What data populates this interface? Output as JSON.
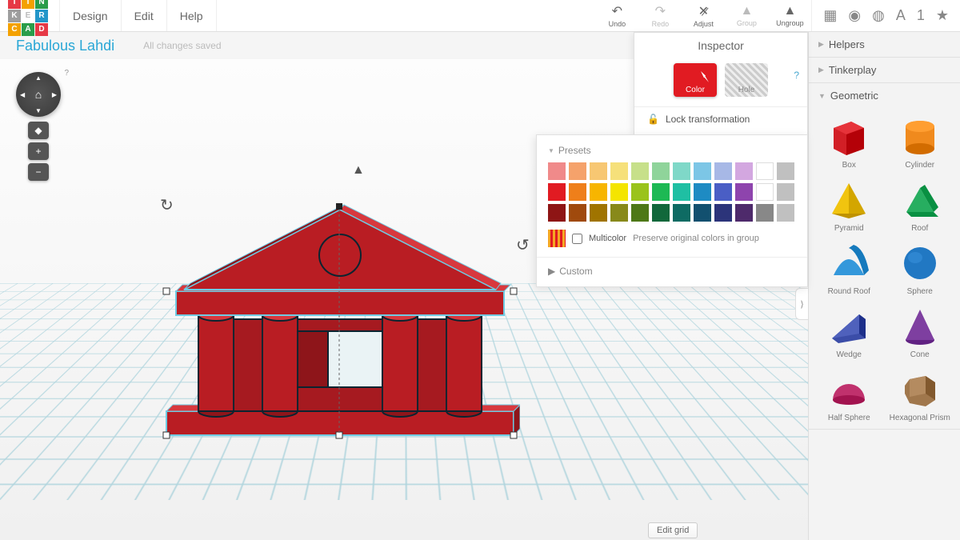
{
  "logo": [
    {
      "t": "T",
      "c": "#e63946"
    },
    {
      "t": "I",
      "c": "#f4a100"
    },
    {
      "t": "N",
      "c": "#2a9d4a"
    },
    {
      "t": "K",
      "c": "#9e9e9e"
    },
    {
      "t": "E",
      "c": "#fff",
      "bg": "#fff",
      "fg": "#bbb"
    },
    {
      "t": "R",
      "c": "#2396c9"
    },
    {
      "t": "C",
      "c": "#f4a100"
    },
    {
      "t": "A",
      "c": "#2a9d4a"
    },
    {
      "t": "D",
      "c": "#e63946"
    }
  ],
  "menu": [
    "Design",
    "Edit",
    "Help"
  ],
  "tools": [
    {
      "label": "Undo",
      "icon": "↶",
      "enabled": true
    },
    {
      "label": "Redo",
      "icon": "↷",
      "enabled": false
    },
    {
      "label": "Adjust",
      "icon": "✕̷",
      "enabled": true
    },
    {
      "label": "Group",
      "icon": "▲",
      "enabled": false
    },
    {
      "label": "Ungroup",
      "icon": "▲",
      "enabled": true
    }
  ],
  "rightTools": [
    "▦",
    "◉",
    "◍",
    "A",
    "1",
    "★"
  ],
  "project_name": "Fabulous Lahdi",
  "saved_text": "All changes saved",
  "nav_q": "?",
  "nav_buttons": [
    "◆",
    "+",
    "−"
  ],
  "inspector": {
    "title": "Inspector",
    "color_label": "Color",
    "hole_label": "Hole",
    "help": "?",
    "lock_label": "Lock transformation",
    "lock_icon": "🔓"
  },
  "presets": {
    "title": "Presets",
    "colors": [
      "#f08a8a",
      "#f5a26b",
      "#f7c772",
      "#f6e07a",
      "#c7e08a",
      "#8fd49a",
      "#7fd8c8",
      "#7cc6e6",
      "#a7b8e6",
      "#d3a7e0",
      "#e8a7c7",
      "#d6b58f",
      "#e11b22",
      "#ef7f1a",
      "#f7b500",
      "#f4e500",
      "#9ac31c",
      "#1db954",
      "#1fbfa3",
      "#1e8bc3",
      "#4a5ec5",
      "#8e44ad",
      "#c2185b",
      "#8d6e63",
      "#8e1515",
      "#a04a0d",
      "#a07400",
      "#88891a",
      "#4e7817",
      "#11683b",
      "#0e6b63",
      "#12506f",
      "#2c347a",
      "#4e2a6b",
      "#6d1b44",
      "#5a4030"
    ],
    "extra_colors": [
      "#ffffff",
      "#c0c0c0",
      "#ffffff",
      "#c0c0c0",
      "#888888",
      "#c0c0c0"
    ],
    "multicolor_label": "Multicolor",
    "multicolor_hint": "Preserve original colors in group",
    "custom_title": "Custom"
  },
  "panels": [
    {
      "title": "Helpers",
      "open": false
    },
    {
      "title": "Tinkerplay",
      "open": false
    },
    {
      "title": "Geometric",
      "open": true
    }
  ],
  "shapes": [
    {
      "name": "Box",
      "kind": "box",
      "color": "#d21f26"
    },
    {
      "name": "Cylinder",
      "kind": "cylinder",
      "color": "#f08a1d"
    },
    {
      "name": "Pyramid",
      "kind": "pyramid",
      "color": "#f1c40f"
    },
    {
      "name": "Roof",
      "kind": "roof",
      "color": "#27ae60"
    },
    {
      "name": "Round Roof",
      "kind": "roundroof",
      "color": "#3498db"
    },
    {
      "name": "Sphere",
      "kind": "sphere",
      "color": "#2178c3"
    },
    {
      "name": "Wedge",
      "kind": "wedge",
      "color": "#3b4da8"
    },
    {
      "name": "Cone",
      "kind": "cone",
      "color": "#7e3fa0"
    },
    {
      "name": "Half Sphere",
      "kind": "halfsphere",
      "color": "#c0316d"
    },
    {
      "name": "Hexagonal Prism",
      "kind": "hexprism",
      "color": "#a0774c"
    }
  ],
  "collapse_icon": "⟩",
  "edit_grid_label": "Edit grid"
}
